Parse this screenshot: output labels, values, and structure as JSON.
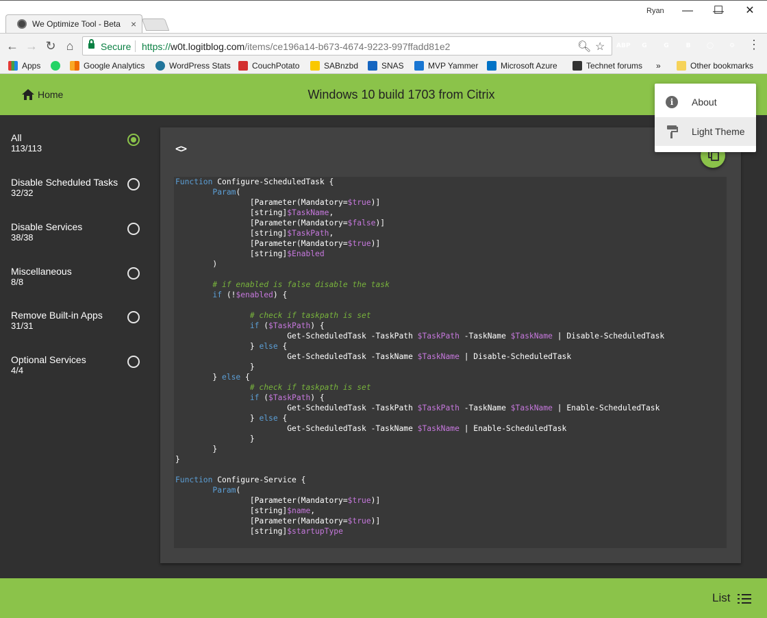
{
  "browser": {
    "tab_title": "We Optimize Tool - Beta",
    "tab_close": "×",
    "profile_name": "Ryan",
    "window_controls": {
      "minimize": "—",
      "maximize": "☐",
      "close": "✕"
    },
    "secure_label": "Secure",
    "url_scheme": "https://",
    "url_host": "w0t.logitblog.com",
    "url_path": "/items/ce196a14-b673-4674-9223-997ffadd81e2",
    "extensions": [
      {
        "name": "ABP",
        "label": "ABP",
        "color": "#c70d2c"
      },
      {
        "name": "grammarly",
        "label": "G",
        "color": "#15c39a"
      },
      {
        "name": "ext-g",
        "label": "G",
        "color": "#9e9e9e"
      },
      {
        "name": "ext-b",
        "label": "B",
        "color": "#9e9e9e"
      },
      {
        "name": "ext-circle",
        "label": "◯",
        "color": "#bdbdbd"
      },
      {
        "name": "ext-gear",
        "label": "⚙",
        "color": "#9e9e9e"
      }
    ],
    "bookmarks": [
      {
        "label": "Apps",
        "color": "#e53935"
      },
      {
        "label": "",
        "color": "#25d366"
      },
      {
        "label": "Google Analytics",
        "color": "#f9a825"
      },
      {
        "label": "WordPress Stats",
        "color": "#21759b"
      },
      {
        "label": "CouchPotato",
        "color": "#d32f2f"
      },
      {
        "label": "SABnzbd",
        "color": "#f9c800"
      },
      {
        "label": "SNAS",
        "color": "#1565c0"
      },
      {
        "label": "MVP Yammer",
        "color": "#1976d2"
      },
      {
        "label": "Microsoft Azure",
        "color": "#0072c6"
      },
      {
        "label": "Technet forums",
        "color": "#333333"
      }
    ],
    "bookmarks_overflow": "»",
    "other_bookmarks": "Other bookmarks"
  },
  "app": {
    "accent": "#8bc34a",
    "home_label": "Home",
    "title": "Windows 10 build 1703 from Citrix",
    "code_toggle": "<>",
    "footer_list_label": "List"
  },
  "categories": [
    {
      "name": "All",
      "count": "113/113",
      "selected": true
    },
    {
      "name": "Disable Scheduled Tasks",
      "count": "32/32",
      "selected": false
    },
    {
      "name": "Disable Services",
      "count": "38/38",
      "selected": false
    },
    {
      "name": "Miscellaneous",
      "count": "8/8",
      "selected": false
    },
    {
      "name": "Remove Built-in Apps",
      "count": "31/31",
      "selected": false
    },
    {
      "name": "Optional Services",
      "count": "4/4",
      "selected": false
    }
  ],
  "menu": {
    "items": [
      {
        "label": "About",
        "icon": "info-icon"
      },
      {
        "label": "Light Theme",
        "icon": "paint-roller-icon"
      }
    ]
  },
  "code": {
    "lines": [
      [
        [
          "k",
          "Function"
        ],
        [
          "t",
          " Configure-ScheduledTask {"
        ]
      ],
      [
        [
          "t",
          "\t"
        ],
        [
          "k",
          "Param"
        ],
        [
          "t",
          "("
        ]
      ],
      [
        [
          "t",
          "\t\t[Parameter(Mandatory="
        ],
        [
          "v",
          "$true"
        ],
        [
          "t",
          ")]"
        ]
      ],
      [
        [
          "t",
          "\t\t[string]"
        ],
        [
          "v",
          "$TaskName"
        ],
        [
          "t",
          ","
        ]
      ],
      [
        [
          "t",
          "\t\t[Parameter(Mandatory="
        ],
        [
          "v",
          "$false"
        ],
        [
          "t",
          ")]"
        ]
      ],
      [
        [
          "t",
          "\t\t[string]"
        ],
        [
          "v",
          "$TaskPath"
        ],
        [
          "t",
          ","
        ]
      ],
      [
        [
          "t",
          "\t\t[Parameter(Mandatory="
        ],
        [
          "v",
          "$true"
        ],
        [
          "t",
          ")]"
        ]
      ],
      [
        [
          "t",
          "\t\t[string]"
        ],
        [
          "v",
          "$Enabled"
        ]
      ],
      [
        [
          "t",
          "\t)"
        ]
      ],
      [
        [
          "t",
          ""
        ]
      ],
      [
        [
          "t",
          "\t"
        ],
        [
          "c",
          "# if enabled is false disable the task"
        ]
      ],
      [
        [
          "t",
          "\t"
        ],
        [
          "k",
          "if"
        ],
        [
          "t",
          " (!"
        ],
        [
          "v",
          "$enabled"
        ],
        [
          "t",
          ") {"
        ]
      ],
      [
        [
          "t",
          ""
        ]
      ],
      [
        [
          "t",
          "\t\t"
        ],
        [
          "c",
          "# check if taskpath is set"
        ]
      ],
      [
        [
          "t",
          "\t\t"
        ],
        [
          "k",
          "if"
        ],
        [
          "t",
          " ("
        ],
        [
          "v",
          "$TaskPath"
        ],
        [
          "t",
          ") {"
        ]
      ],
      [
        [
          "t",
          "\t\t\tGet-ScheduledTask -TaskPath "
        ],
        [
          "v",
          "$TaskPath"
        ],
        [
          "t",
          " -TaskName "
        ],
        [
          "v",
          "$TaskName"
        ],
        [
          "t",
          " | Disable-ScheduledTask"
        ]
      ],
      [
        [
          "t",
          "\t\t} "
        ],
        [
          "k",
          "else"
        ],
        [
          "t",
          " {"
        ]
      ],
      [
        [
          "t",
          "\t\t\tGet-ScheduledTask -TaskName "
        ],
        [
          "v",
          "$TaskName"
        ],
        [
          "t",
          " | Disable-ScheduledTask"
        ]
      ],
      [
        [
          "t",
          "\t\t}"
        ]
      ],
      [
        [
          "t",
          "\t} "
        ],
        [
          "k",
          "else"
        ],
        [
          "t",
          " {"
        ]
      ],
      [
        [
          "t",
          "\t\t"
        ],
        [
          "c",
          "# check if taskpath is set"
        ]
      ],
      [
        [
          "t",
          "\t\t"
        ],
        [
          "k",
          "if"
        ],
        [
          "t",
          " ("
        ],
        [
          "v",
          "$TaskPath"
        ],
        [
          "t",
          ") {"
        ]
      ],
      [
        [
          "t",
          "\t\t\tGet-ScheduledTask -TaskPath "
        ],
        [
          "v",
          "$TaskPath"
        ],
        [
          "t",
          " -TaskName "
        ],
        [
          "v",
          "$TaskName"
        ],
        [
          "t",
          " | Enable-ScheduledTask"
        ]
      ],
      [
        [
          "t",
          "\t\t} "
        ],
        [
          "k",
          "else"
        ],
        [
          "t",
          " {"
        ]
      ],
      [
        [
          "t",
          "\t\t\tGet-ScheduledTask -TaskName "
        ],
        [
          "v",
          "$TaskName"
        ],
        [
          "t",
          " | Enable-ScheduledTask"
        ]
      ],
      [
        [
          "t",
          "\t\t}"
        ]
      ],
      [
        [
          "t",
          "\t}"
        ]
      ],
      [
        [
          "t",
          "}"
        ]
      ],
      [
        [
          "t",
          ""
        ]
      ],
      [
        [
          "k",
          "Function"
        ],
        [
          "t",
          " Configure-Service {"
        ]
      ],
      [
        [
          "t",
          "\t"
        ],
        [
          "k",
          "Param"
        ],
        [
          "t",
          "("
        ]
      ],
      [
        [
          "t",
          "\t\t[Parameter(Mandatory="
        ],
        [
          "v",
          "$true"
        ],
        [
          "t",
          ")]"
        ]
      ],
      [
        [
          "t",
          "\t\t[string]"
        ],
        [
          "v",
          "$name"
        ],
        [
          "t",
          ","
        ]
      ],
      [
        [
          "t",
          "\t\t[Parameter(Mandatory="
        ],
        [
          "v",
          "$true"
        ],
        [
          "t",
          ")]"
        ]
      ],
      [
        [
          "t",
          "\t\t[string]"
        ],
        [
          "v",
          "$startupType"
        ]
      ]
    ]
  }
}
